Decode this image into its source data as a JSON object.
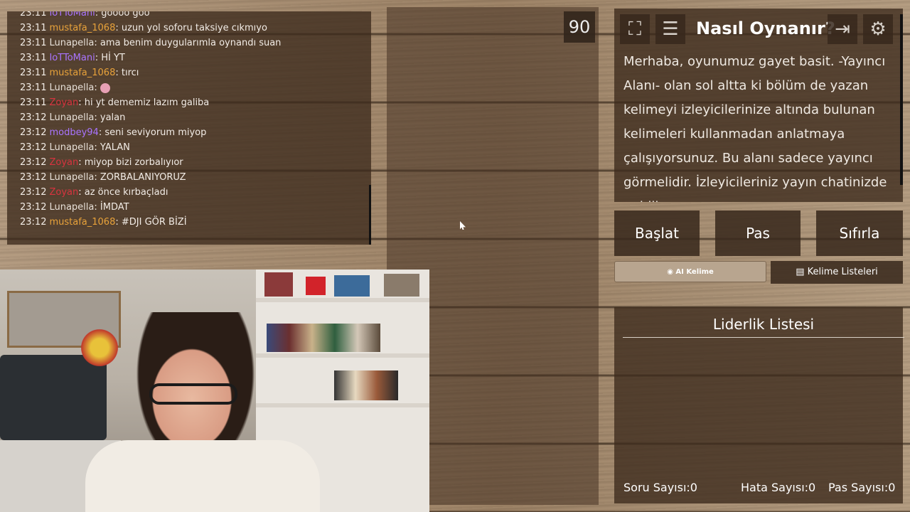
{
  "chat": {
    "messages": [
      {
        "time": "23:11",
        "user": "IoTToMani",
        "color": "#a974ff",
        "text": "goooo goo"
      },
      {
        "time": "23:11",
        "user": "mustafa_1068",
        "color": "#e8a23a",
        "text": "uzun yol soforu taksiye cıkmıyo"
      },
      {
        "time": "23:11",
        "user": "Lunapella",
        "color": "#e7e0d8",
        "text": "ama benim duygularımla oynandı suan"
      },
      {
        "time": "23:11",
        "user": "IoTToMani",
        "color": "#a974ff",
        "text": "Hİ YT"
      },
      {
        "time": "23:11",
        "user": "mustafa_1068",
        "color": "#e8a23a",
        "text": "tırcı"
      },
      {
        "time": "23:11",
        "user": "Lunapella",
        "color": "#e7e0d8",
        "text": ""
      },
      {
        "time": "23:11",
        "user": "Zoyan",
        "color": "#d8333f",
        "text": "hi yt dememiz lazım galiba"
      },
      {
        "time": "23:12",
        "user": "Lunapella",
        "color": "#e7e0d8",
        "text": "yalan"
      },
      {
        "time": "23:12",
        "user": "modbey94",
        "color": "#a974ff",
        "text": "seni seviyorum miyop"
      },
      {
        "time": "23:12",
        "user": "Lunapella",
        "color": "#e7e0d8",
        "text": "YALAN"
      },
      {
        "time": "23:12",
        "user": "Zoyan",
        "color": "#d8333f",
        "text": "miyop bizi zorbalıyıor"
      },
      {
        "time": "23:12",
        "user": "Lunapella",
        "color": "#e7e0d8",
        "text": "ZORBALANIYORUZ"
      },
      {
        "time": "23:12",
        "user": "Zoyan",
        "color": "#d8333f",
        "text": "az önce kırbaçladı"
      },
      {
        "time": "23:12",
        "user": "Lunapella",
        "color": "#e7e0d8",
        "text": "İMDAT"
      },
      {
        "time": "23:12",
        "user": "mustafa_1068",
        "color": "#e8a23a",
        "text": "#DJI GÖR BİZİ"
      }
    ]
  },
  "timer": {
    "value": "90"
  },
  "howto": {
    "title": "Nasıl Oynanır?",
    "text": "Merhaba, oyunumuz gayet basit. -Yayıncı Alanı- olan sol altta ki bölüm de yazan kelimeyi izleyicilerinize altında bulunan kelimeleri kullanmadan anlatmaya çalışıyorsunuz. Bu alanı sadece yayıncı görmelidir. İzleyicileriniz yayın chatinizde ... bili",
    "icons": [
      "fullscreen-icon",
      "document-icon",
      "exit-icon",
      "gear-icon"
    ]
  },
  "actions": {
    "start": "Başlat",
    "pass": "Pas",
    "reset": "Sıfırla"
  },
  "ai_button": {
    "label": "AI Kelime"
  },
  "lists_button": {
    "label": "Kelime Listeleri"
  },
  "leaderboard": {
    "title": "Liderlik Listesi",
    "stats": {
      "questions_label": "Soru Sayısı:",
      "questions_value": "0",
      "errors_label": "Hata Sayısı:",
      "errors_value": "0",
      "passes_label": "Pas Sayısı:",
      "passes_value": "0"
    }
  },
  "colors": {
    "panel": "#3c2a1c",
    "accent_ai": "#b8a58f"
  }
}
